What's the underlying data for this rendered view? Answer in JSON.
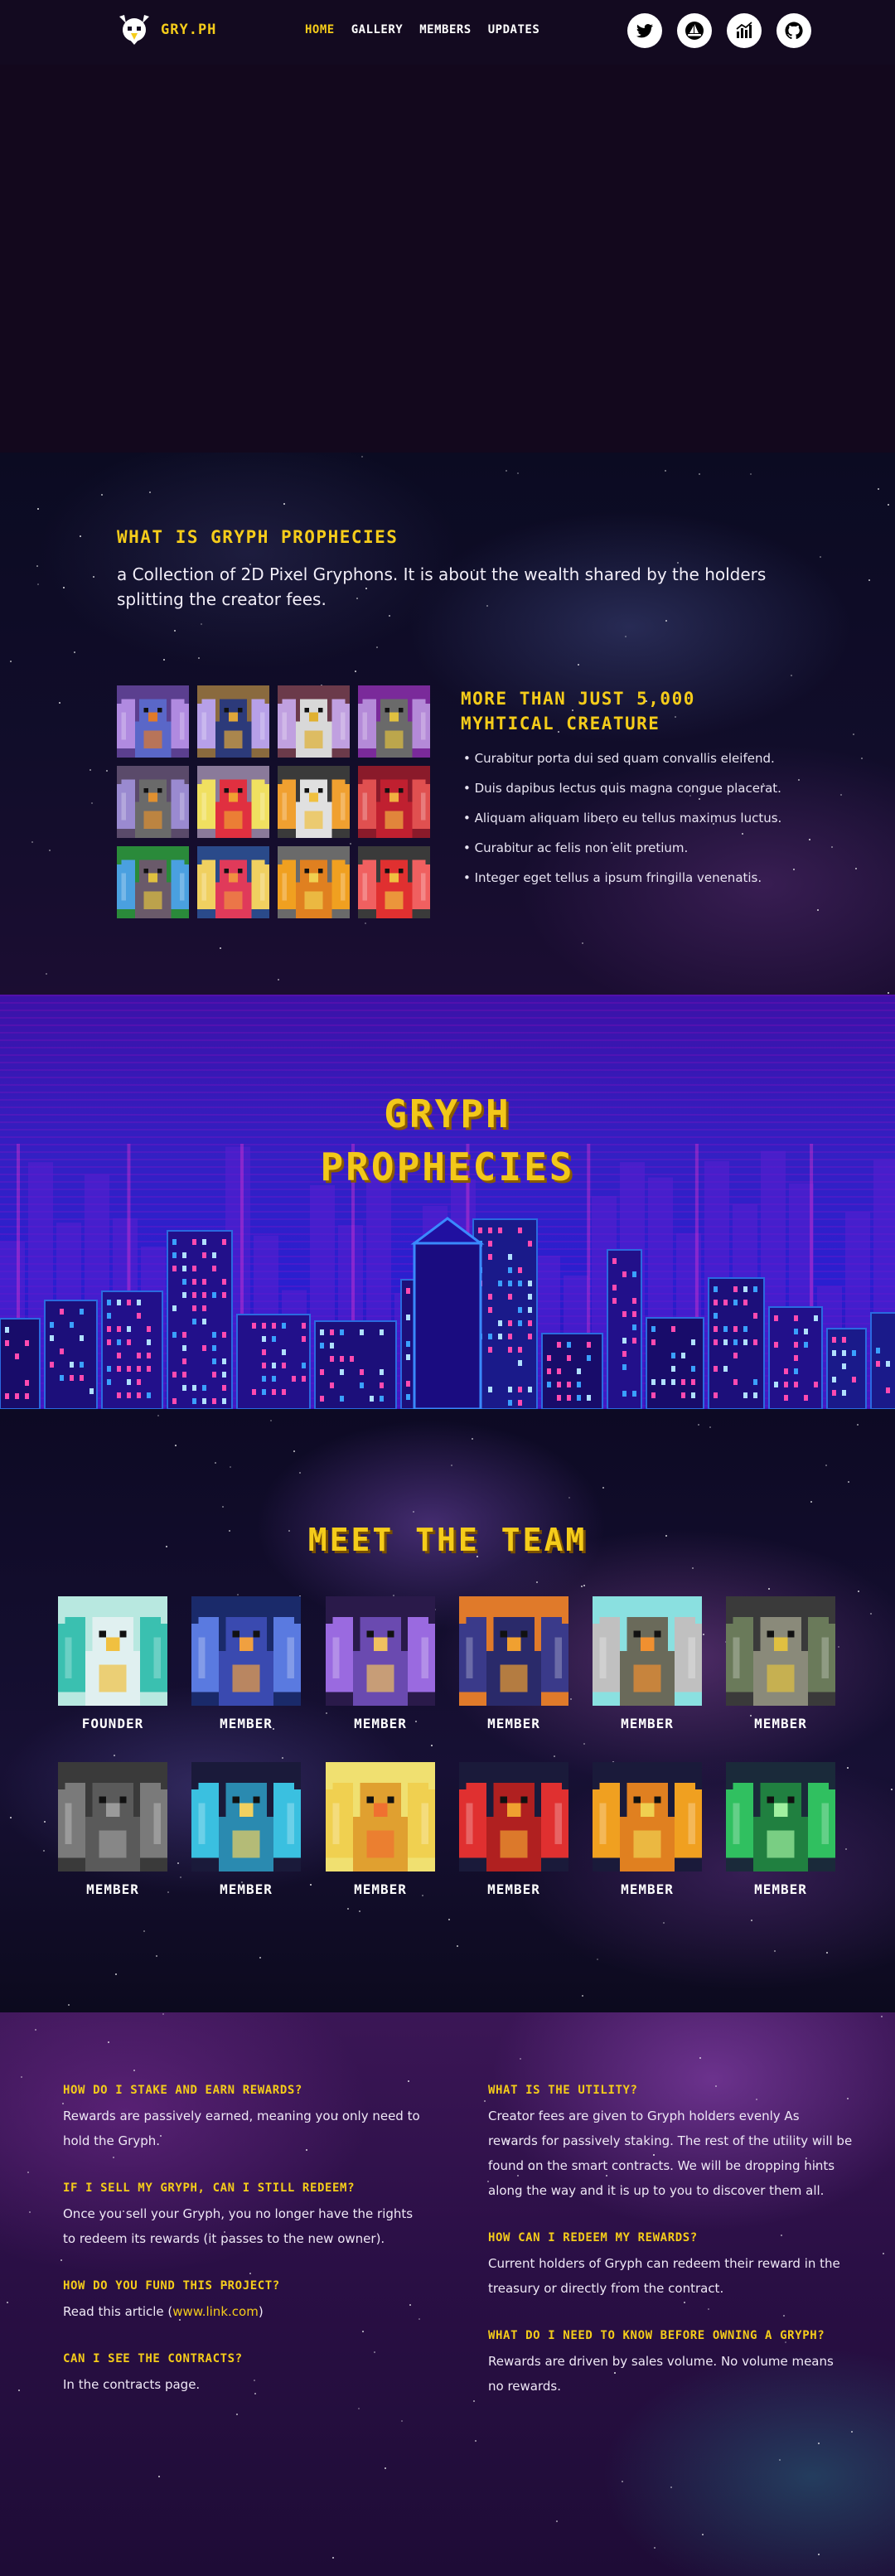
{
  "header": {
    "brand": "GRY.PH",
    "nav": [
      {
        "label": "HOME",
        "active": true
      },
      {
        "label": "GALLERY",
        "active": false
      },
      {
        "label": "MEMBERS",
        "active": false
      },
      {
        "label": "UPDATES",
        "active": false
      }
    ],
    "socials": [
      "twitter-icon",
      "opensea-icon",
      "chart-icon",
      "github-icon"
    ]
  },
  "about": {
    "title": "WHAT IS GRYPH PROPHECIES",
    "description": "a Collection of 2D Pixel Gryphons. It is about the wealth shared by the holders splitting the creator fees.",
    "features_title": "MORE THAN JUST 5,000 MYHTICAL CREATURE",
    "features": [
      "Curabitur porta dui sed quam convallis eleifend.",
      "Duis dapibus lectus quis magna congue placerat.",
      "Aliquam aliquam libero eu tellus maximus luctus.",
      "Curabitur ac felis non elit pretium.",
      "Integer eget tellus a ipsum fringilla venenatis."
    ]
  },
  "banner": {
    "line1": "GRYPH",
    "line2": "PROPHECIES"
  },
  "team": {
    "title": "MEET THE TEAM",
    "members": [
      {
        "role": "FOUNDER"
      },
      {
        "role": "MEMBER"
      },
      {
        "role": "MEMBER"
      },
      {
        "role": "MEMBER"
      },
      {
        "role": "MEMBER"
      },
      {
        "role": "MEMBER"
      },
      {
        "role": "MEMBER"
      },
      {
        "role": "MEMBER"
      },
      {
        "role": "MEMBER"
      },
      {
        "role": "MEMBER"
      },
      {
        "role": "MEMBER"
      },
      {
        "role": "MEMBER"
      }
    ]
  },
  "faq": {
    "left": [
      {
        "q": "HOW DO I STAKE AND EARN REWARDS?",
        "a": "Rewards are passively earned, meaning you only need to hold the Gryph."
      },
      {
        "q": "IF I SELL MY GRYPH, CAN I STILL REDEEM?",
        "a": "Once you sell your Gryph, you no longer have the rights to redeem its rewards (it passes to the new owner)."
      },
      {
        "q": "HOW DO YOU FUND THIS PROJECT?",
        "a_prefix": "Read this article (",
        "a_link": "www.link.com",
        "a_suffix": ")"
      },
      {
        "q": "CAN I SEE THE CONTRACTS?",
        "a": "In the contracts page."
      }
    ],
    "right": [
      {
        "q": "WHAT IS THE UTILITY?",
        "a": "Creator fees are given to Gryph holders evenly As rewards for passively staking. The rest of the utility will be found on the smart contracts. We will be dropping hints along the way and it is up to you to discover them all."
      },
      {
        "q": "HOW CAN I REDEEM MY REWARDS?",
        "a": "Current holders of Gryph can redeem their reward in the treasury or directly from the contract."
      },
      {
        "q": "WHAT DO I NEED TO KNOW BEFORE OWNING A GRYPH?",
        "a": "Rewards are driven by sales volume. No volume means no rewards."
      }
    ]
  },
  "colors": {
    "accent": "#f5cc1a",
    "header_bg": "#130a20"
  }
}
